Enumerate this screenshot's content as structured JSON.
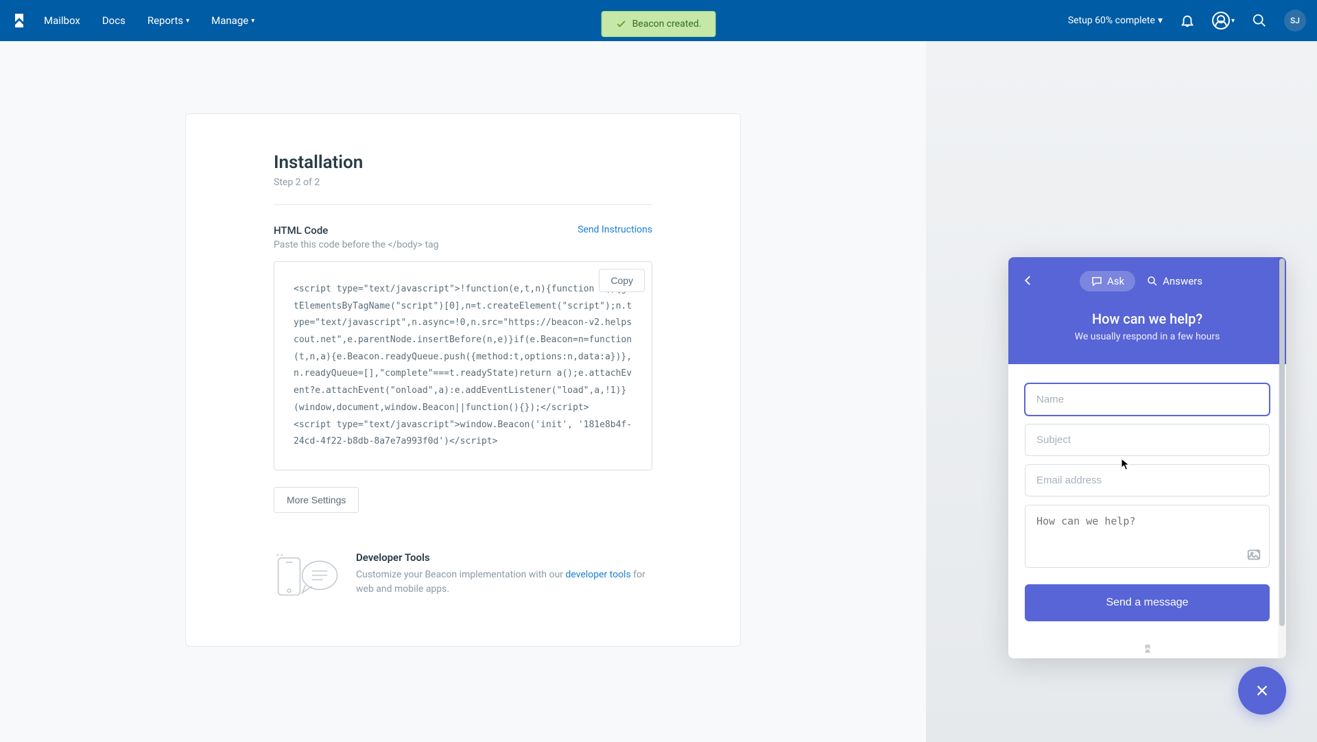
{
  "nav": {
    "items": [
      "Mailbox",
      "Docs",
      "Reports",
      "Manage"
    ],
    "setup_text": "Setup 60% complete",
    "avatar_initials": "SJ"
  },
  "toast": {
    "message": "Beacon created."
  },
  "card": {
    "title": "Installation",
    "step": "Step 2 of 2",
    "html_code_label": "HTML Code",
    "html_code_hint": "Paste this code before the </body> tag",
    "send_instructions": "Send Instructions",
    "copy_label": "Copy",
    "code": "<script type=\"text/javascript\">!function(e,t,n){function a(){getElementsByTagName(\"script\")[0],n=t.createElement(\"script\");n.type=\"text/javascript\",n.async=!0,n.src=\"https://beacon-v2.helpscout.net\",e.parentNode.insertBefore(n,e)}if(e.Beacon=n=function(t,n,a){e.Beacon.readyQueue.push({method:t,options:n,data:a})},n.readyQueue=[],\"complete\"===t.readyState)return a();e.attachEvent?e.attachEvent(\"onload\",a):e.addEventListener(\"load\",a,!1)}(window,document,window.Beacon||function(){});</script>\n<script type=\"text/javascript\">window.Beacon('init', '181e8b4f-24cd-4f22-b8db-8a7e7a993f0d')</script>",
    "more_settings": "More Settings",
    "dev_tools_title": "Developer Tools",
    "dev_tools_text_1": "Customize your Beacon implementation with our ",
    "dev_tools_link": "developer tools",
    "dev_tools_text_2": " for web and mobile apps."
  },
  "beacon": {
    "tab_ask": "Ask",
    "tab_answers": "Answers",
    "title": "How can we help?",
    "subtitle": "We usually respond in a few hours",
    "name_placeholder": "Name",
    "subject_placeholder": "Subject",
    "email_placeholder": "Email address",
    "message_placeholder": "How can we help?",
    "send_label": "Send a message"
  }
}
